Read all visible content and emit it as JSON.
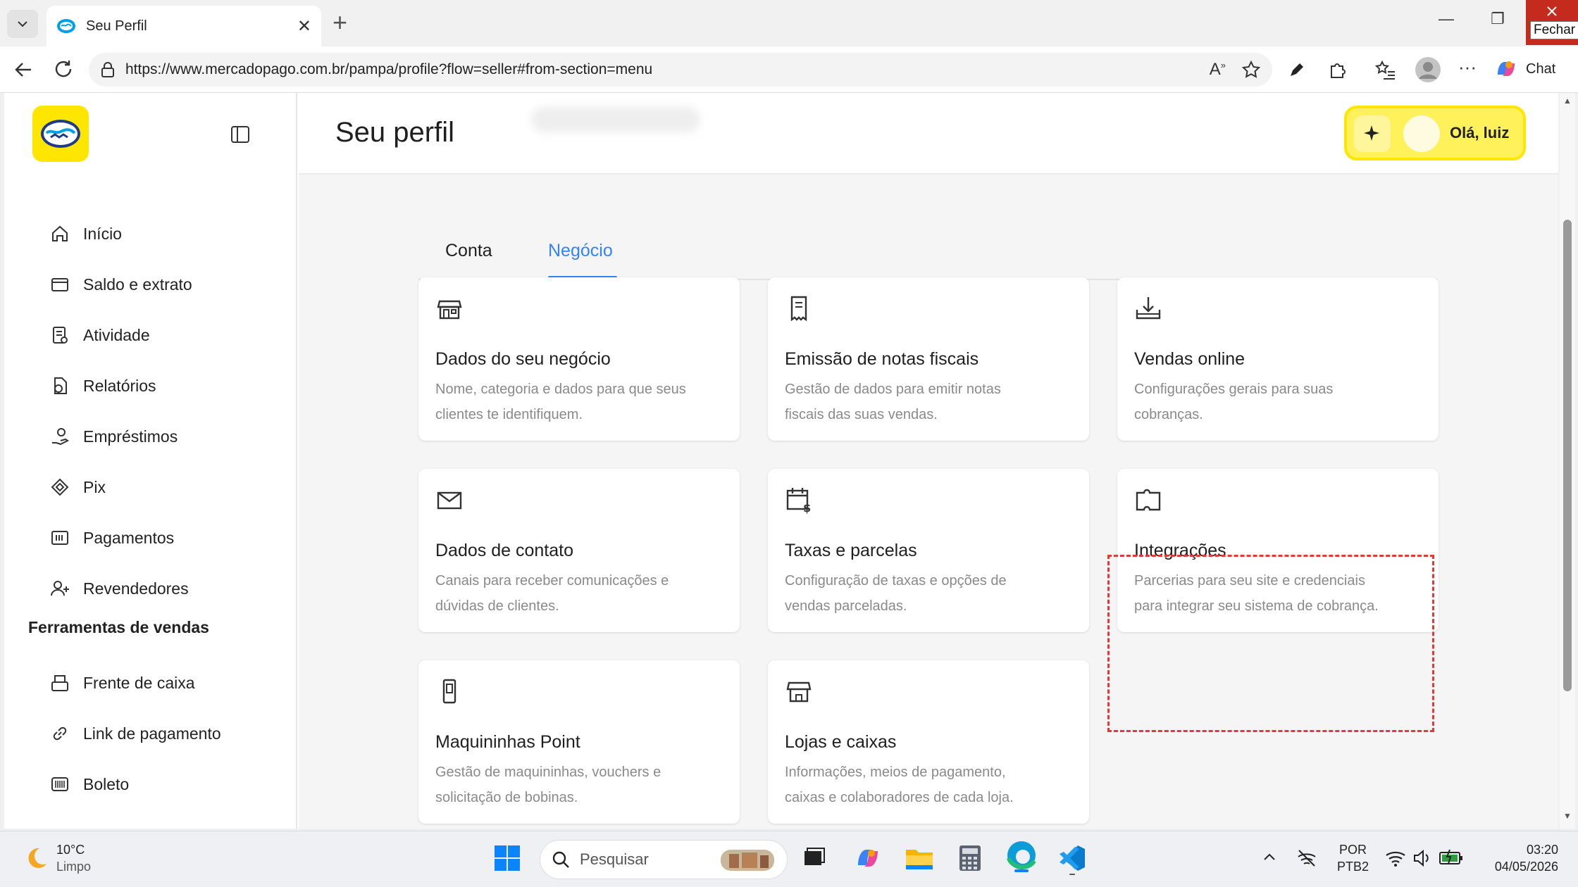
{
  "browser": {
    "tab_title": "Seu Perfil",
    "url": "https://www.mercadopago.com.br/pampa/profile?flow=seller#from-section=menu",
    "close_tooltip": "Fechar",
    "chat_label": "Chat"
  },
  "sidebar": {
    "items": [
      {
        "label": "Início",
        "icon": "home-icon"
      },
      {
        "label": "Saldo e extrato",
        "icon": "wallet-icon"
      },
      {
        "label": "Atividade",
        "icon": "activity-icon"
      },
      {
        "label": "Relatórios",
        "icon": "reports-icon"
      },
      {
        "label": "Empréstimos",
        "icon": "loans-icon"
      },
      {
        "label": "Pix",
        "icon": "pix-icon"
      },
      {
        "label": "Pagamentos",
        "icon": "payments-icon"
      },
      {
        "label": "Revendedores",
        "icon": "resellers-icon"
      }
    ],
    "section_title": "Ferramentas de vendas",
    "tools": [
      {
        "label": "Frente de caixa",
        "icon": "register-icon"
      },
      {
        "label": "Link de pagamento",
        "icon": "link-icon"
      },
      {
        "label": "Boleto",
        "icon": "barcode-icon"
      }
    ]
  },
  "header": {
    "title": "Seu perfil",
    "greeting": "Olá, luiz"
  },
  "tabs": [
    {
      "label": "Conta",
      "active": false
    },
    {
      "label": "Negócio",
      "active": true
    }
  ],
  "cards": [
    {
      "title": "Dados do seu negócio",
      "desc1": "Nome, categoria e dados para que seus",
      "desc2": "clientes te identifiquem.",
      "icon": "store-icon"
    },
    {
      "title": "Emissão de notas fiscais",
      "desc1": "Gestão de dados para emitir notas",
      "desc2": "fiscais das suas vendas.",
      "icon": "receipt-icon"
    },
    {
      "title": "Vendas online",
      "desc1": "Configurações gerais para suas",
      "desc2": "cobranças.",
      "icon": "download-tray-icon"
    },
    {
      "title": "Dados de contato",
      "desc1": "Canais para receber comunicações e",
      "desc2": "dúvidas de clientes.",
      "icon": "envelope-icon"
    },
    {
      "title": "Taxas e parcelas",
      "desc1": "Configuração de taxas e opções de",
      "desc2": "vendas parceladas.",
      "icon": "calendar-money-icon"
    },
    {
      "title": "Integrações",
      "desc1": "Parcerias para seu site e credenciais",
      "desc2": "para integrar seu sistema de cobrança.",
      "icon": "puzzle-icon"
    },
    {
      "title": "Maquininhas Point",
      "desc1": "Gestão de maquininhas, vouchers e",
      "desc2": "solicitação de bobinas.",
      "icon": "pos-icon"
    },
    {
      "title": "Lojas e caixas",
      "desc1": "Informações, meios de pagamento,",
      "desc2": "caixas e colaboradores de cada loja.",
      "icon": "shop-icon"
    }
  ],
  "taskbar": {
    "temp": "10°C",
    "weather": "Limpo",
    "search_placeholder": "Pesquisar",
    "lang1": "POR",
    "lang2": "PTB2",
    "time": "03:20",
    "date": "04/05/2026"
  },
  "colors": {
    "brand_yellow": "#ffe600",
    "accent_blue": "#3483fa",
    "highlight_red": "#e53935"
  }
}
